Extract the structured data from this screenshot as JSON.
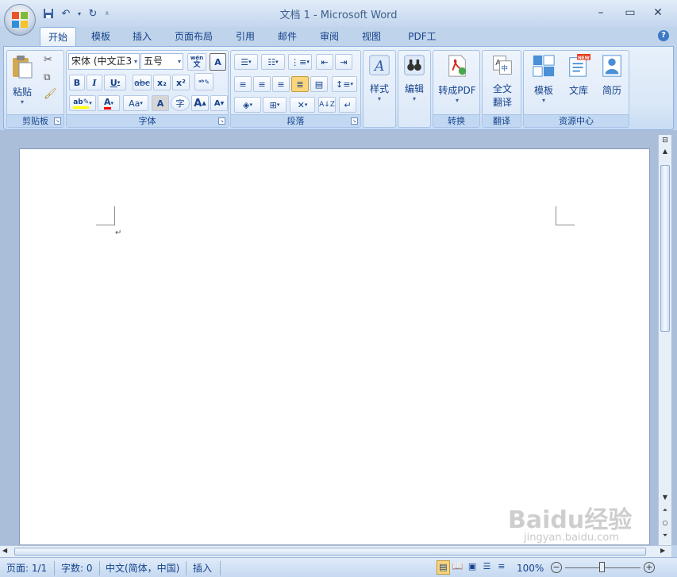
{
  "window": {
    "title": "文档 1 - Microsoft Word"
  },
  "tabs": [
    "开始",
    "模板",
    "插入",
    "页面布局",
    "引用",
    "邮件",
    "审阅",
    "视图",
    "PDF工具"
  ],
  "ribbon": {
    "clipboard": {
      "paste": "粘贴",
      "label": "剪贴板"
    },
    "font": {
      "font_name": "宋体 (中文正3",
      "font_size": "五号",
      "wen": "wén\n文",
      "label": "字体",
      "bold": "B",
      "italic": "I",
      "underline": "U",
      "strike": "abc",
      "sub": "x₂",
      "sup": "x²",
      "aa": "Aa",
      "grow": "A",
      "shrink": "A",
      "charshade": "A",
      "enclose": "字"
    },
    "paragraph": {
      "label": "段落"
    },
    "styles": {
      "label": "样式"
    },
    "editing": {
      "label": "编辑"
    },
    "convert": {
      "button": "转成PDF",
      "label": "转换"
    },
    "translate": {
      "line1": "全文",
      "line2": "翻译",
      "label": "翻译"
    },
    "resources": {
      "templates": "模板",
      "library": "文库",
      "resume": "简历",
      "new_badge": "NEW",
      "label": "资源中心"
    }
  },
  "document": {
    "paragraph_mark": "↵"
  },
  "statusbar": {
    "page": "页面: 1/1",
    "words": "字数: 0",
    "language": "中文(简体，中国)",
    "mode": "插入",
    "zoom": "100%"
  },
  "watermark": {
    "text": "Baidu经验",
    "url": "jingyan.baidu.com"
  },
  "colors": {
    "accent": "#15428b",
    "ribbon_bg": "#dbe8f8",
    "highlight": "#ffff00",
    "font_color": "#ff0000",
    "active_align": "#fbd57a"
  }
}
